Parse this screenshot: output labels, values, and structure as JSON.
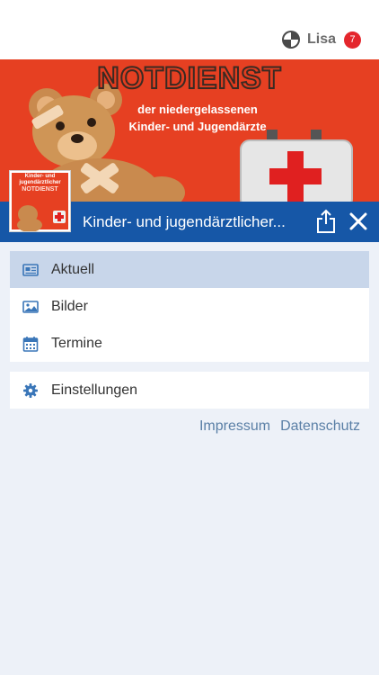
{
  "header": {
    "user_name": "Lisa",
    "notification_count": "7"
  },
  "banner": {
    "title": "NOTDIENST",
    "subtitle_line1": "der niedergelassenen",
    "subtitle_line2": "Kinder- und Jugendärzte"
  },
  "thumbnail": {
    "line1": "Kinder- und",
    "line2": "jugendärztlicher",
    "line3": "NOTDIENST"
  },
  "titlebar": {
    "title": "Kinder- und jugendärztlicher..."
  },
  "menu": {
    "main": [
      {
        "label": "Aktuell",
        "icon": "news-icon"
      },
      {
        "label": "Bilder",
        "icon": "image-icon"
      },
      {
        "label": "Termine",
        "icon": "calendar-icon"
      }
    ],
    "settings": {
      "label": "Einstellungen",
      "icon": "gear-icon"
    }
  },
  "footer": {
    "impressum": "Impressum",
    "datenschutz": "Datenschutz"
  },
  "colors": {
    "accent": "#1657a7",
    "badge": "#e4262c",
    "active_item": "#c8d6ea",
    "link": "#5a7fa6"
  }
}
